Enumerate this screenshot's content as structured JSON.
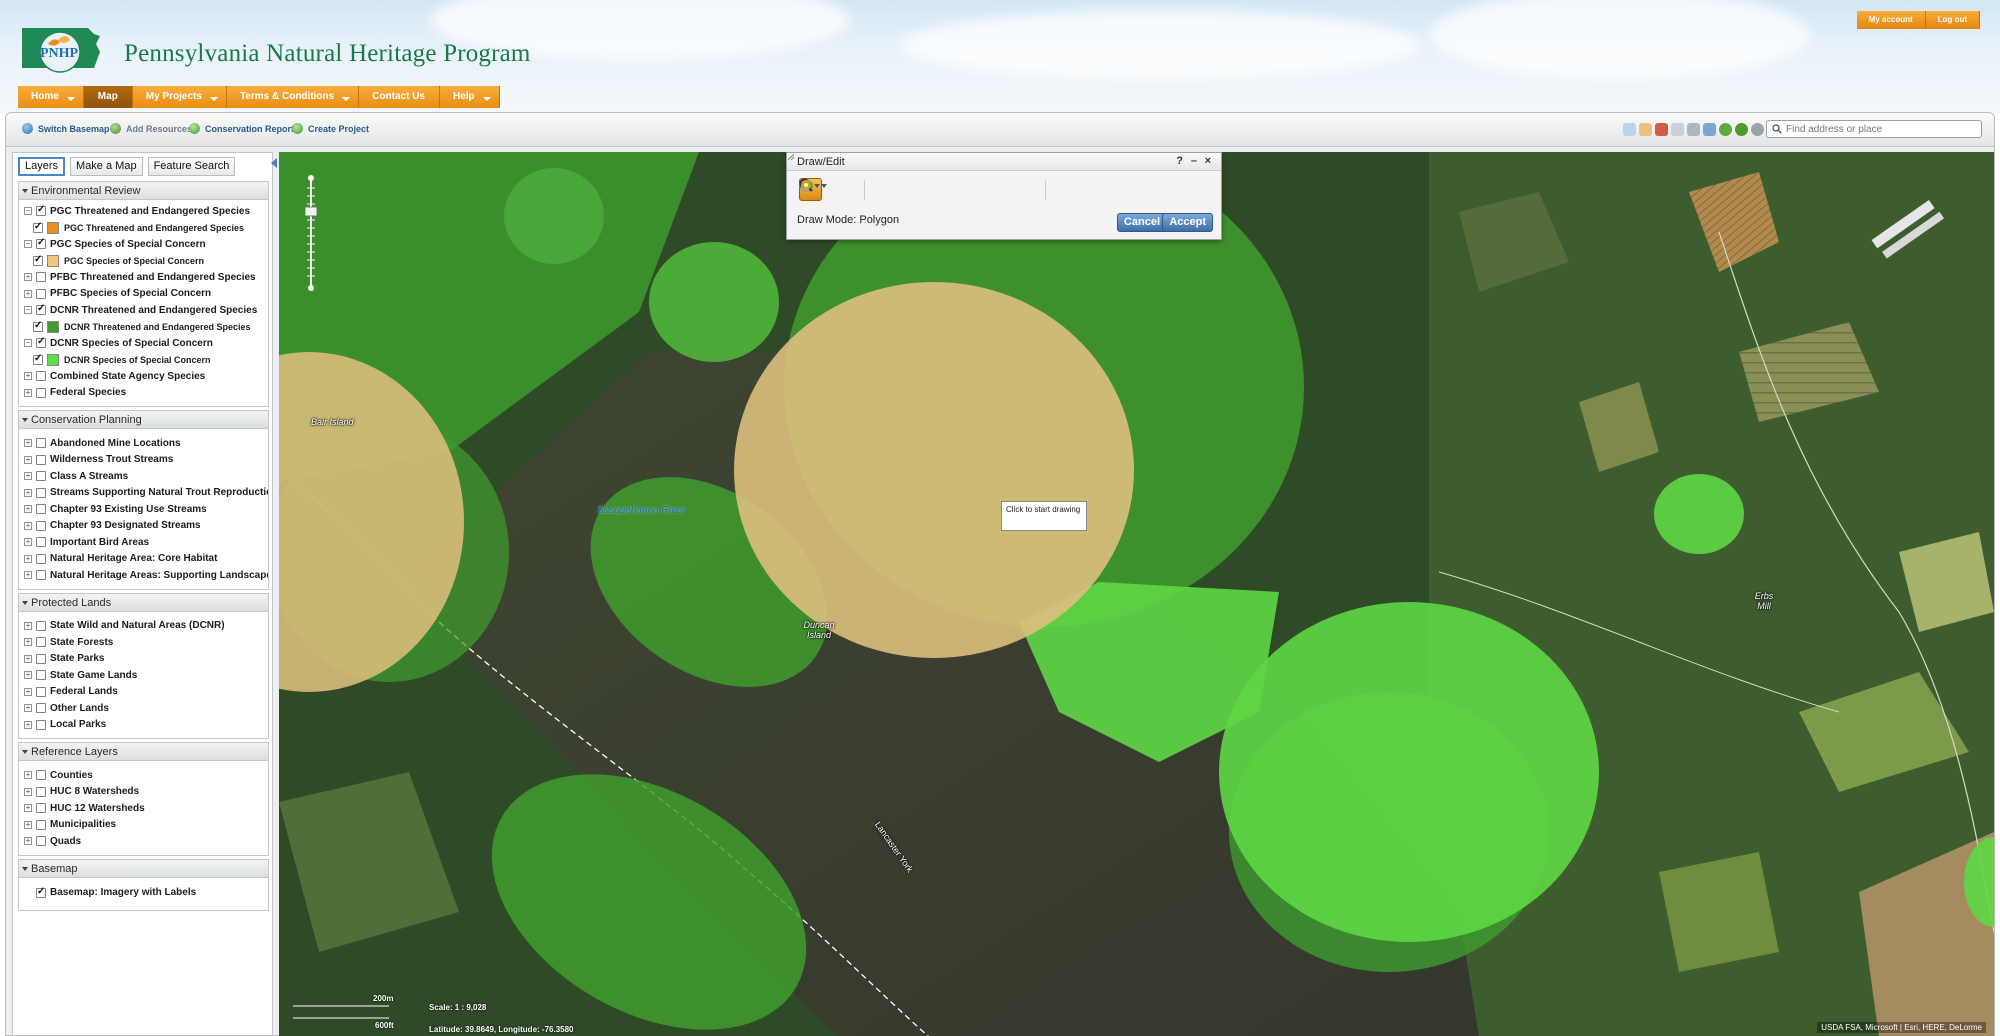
{
  "header": {
    "logo_text": "PNHP",
    "site_title": "Pennsylvania Natural Heritage Program",
    "nav": [
      {
        "label": "Home"
      },
      {
        "label": "Map"
      },
      {
        "label": "My Projects"
      },
      {
        "label": "Terms & Conditions"
      },
      {
        "label": "Contact Us"
      },
      {
        "label": "Help"
      }
    ],
    "account": {
      "my_account": "My account",
      "log_out": "Log out"
    }
  },
  "toolbar": {
    "switch_basemap": "Switch Basemap",
    "add_resources": "Add Resources",
    "conservation_report": "Conservation Report",
    "create_project": "Create Project",
    "search_placeholder": "Find address or place"
  },
  "panel": {
    "tabs": [
      "Layers",
      "Make a Map",
      "Feature Search"
    ],
    "sections": {
      "env": {
        "title": "Environmental Review",
        "rows": [
          "PGC Threatened and Endangered Species",
          "PGC Threatened and Endangered Species",
          "PGC Species of Special Concern",
          "PGC Species of Special Concern",
          "PFBC Threatened and Endangered Species",
          "PFBC Species of Special Concern",
          "DCNR Threatened and Endangered Species",
          "DCNR Threatened and Endangered Species",
          "DCNR Species of Special Concern",
          "DCNR Species of Special Concern",
          "Combined State Agency Species",
          "Federal Species"
        ]
      },
      "cons": {
        "title": "Conservation Planning",
        "rows": [
          "Abandoned Mine Locations",
          "Wilderness Trout Streams",
          "Class A Streams",
          "Streams Supporting Natural Trout Reproduction",
          "Chapter 93 Existing Use Streams",
          "Chapter 93 Designated Streams",
          "Important Bird Areas",
          "Natural Heritage Area: Core Habitat",
          "Natural Heritage Areas: Supporting Landscape"
        ]
      },
      "prot": {
        "title": "Protected Lands",
        "rows": [
          "State Wild and Natural Areas (DCNR)",
          "State Forests",
          "State Parks",
          "State Game Lands",
          "Federal Lands",
          "Other Lands",
          "Local Parks"
        ]
      },
      "ref": {
        "title": "Reference Layers",
        "rows": [
          "Counties",
          "HUC 8 Watersheds",
          "HUC 12 Watersheds",
          "Municipalities",
          "Quads"
        ]
      },
      "base": {
        "title": "Basemap",
        "rows": [
          "Basemap: Imagery with Labels"
        ]
      }
    },
    "swatch_colors": {
      "pgc_te": "#e88f1f",
      "pgc_ssc": "#f2c47e",
      "dcnr_te": "#3e9e2c",
      "dcnr_ssc": "#5fe04a"
    }
  },
  "map": {
    "labels": {
      "bair_island": "Bair Island",
      "river": "Susquehanna River",
      "duncan_island": "Duncan Island",
      "erbs_mill": "Erbs Mill",
      "county_line": "Lancaster York"
    },
    "draw_edit": {
      "title": "Draw/Edit",
      "help": "?",
      "minimize": "–",
      "close": "×",
      "mode": "Draw Mode: Polygon",
      "cancel": "Cancel",
      "accept": "Accept"
    },
    "tooltip": "Click to start drawing",
    "scale": {
      "metric": "200m",
      "imperial": "600ft",
      "ratio": "Scale: 1 : 9,028",
      "coords": "Latitude: 39.8649, Longitude: -76.3580"
    },
    "attribution": "USDA FSA, Microsoft | Esri, HERE, DeLorme"
  }
}
